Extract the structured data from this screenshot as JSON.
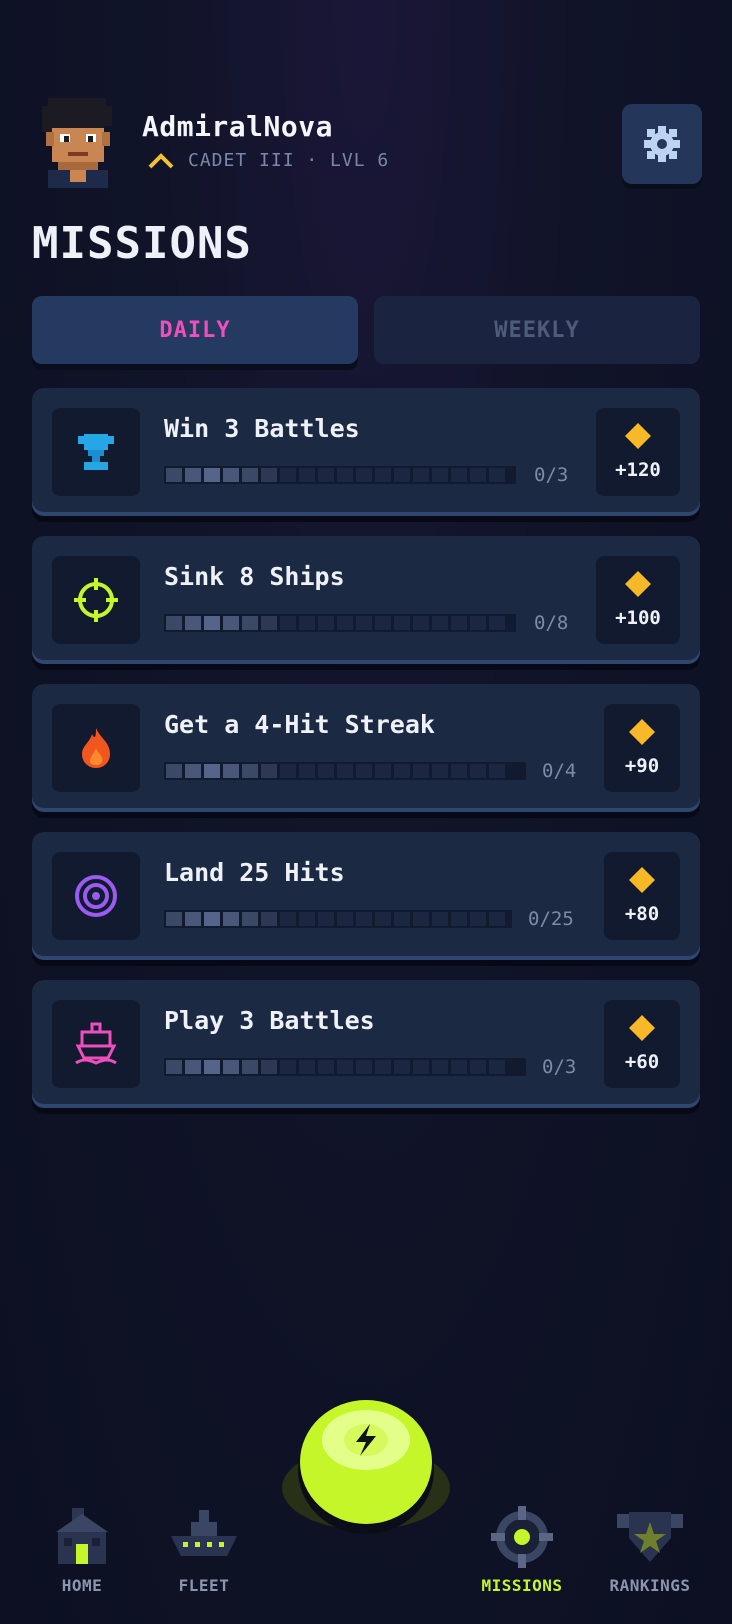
{
  "profile": {
    "username": "AdmiralNova",
    "rank": "CADET III · LVL 6"
  },
  "page": {
    "title": "MISSIONS"
  },
  "tabs": [
    {
      "label": "DAILY",
      "active": true
    },
    {
      "label": "WEEKLY",
      "active": false
    }
  ],
  "missions": [
    {
      "title": "Win 3 Battles",
      "progress": "0/3",
      "reward": "+120",
      "icon": "trophy-icon"
    },
    {
      "title": "Sink 8 Ships",
      "progress": "0/8",
      "reward": "+100",
      "icon": "crosshair-icon"
    },
    {
      "title": "Get a 4-Hit Streak",
      "progress": "0/4",
      "reward": "+90",
      "icon": "flame-icon"
    },
    {
      "title": "Land 25 Hits",
      "progress": "0/25",
      "reward": "+80",
      "icon": "target-icon"
    },
    {
      "title": "Play 3 Battles",
      "progress": "0/3",
      "reward": "+60",
      "icon": "ship-icon"
    }
  ],
  "nav": {
    "home": "HOME",
    "fleet": "FLEET",
    "missions": "MISSIONS",
    "rankings": "RANKINGS"
  },
  "colors": {
    "accent_pink": "#f04dbd",
    "accent_lime": "#c5f62a",
    "reward_gold": "#f7b928"
  }
}
